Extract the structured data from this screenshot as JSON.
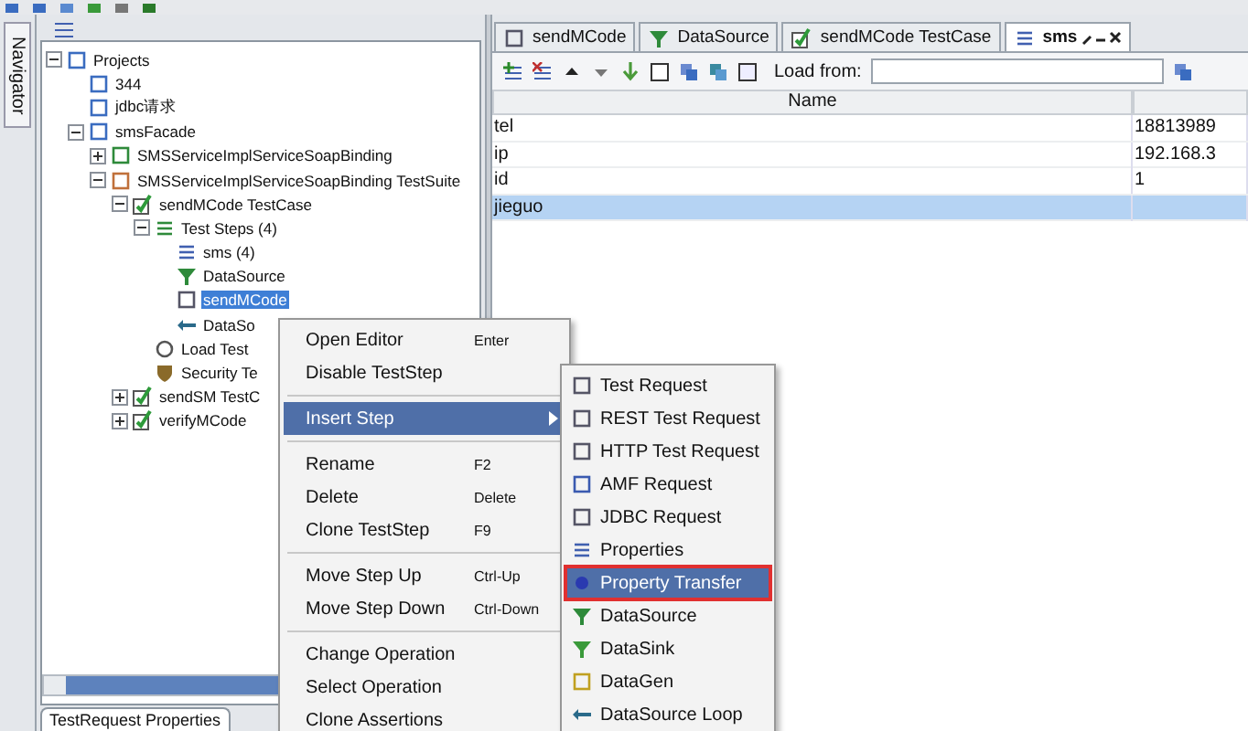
{
  "navigator": {
    "label": "Navigator"
  },
  "tree": [
    {
      "label": "Projects",
      "kind": "projects",
      "expanded": true,
      "selected": false,
      "children": [
        {
          "label": "344",
          "kind": "project",
          "selected": false
        },
        {
          "label": "jdbc请求",
          "kind": "project",
          "selected": false
        },
        {
          "label": "smsFacade",
          "kind": "project",
          "expanded": true,
          "selected": false,
          "children": [
            {
              "label": "SMSServiceImplServiceSoapBinding",
              "kind": "interface",
              "expanded": false,
              "selected": false
            },
            {
              "label": "SMSServiceImplServiceSoapBinding TestSuite",
              "kind": "suite",
              "expanded": true,
              "selected": false,
              "children": [
                {
                  "label": "sendMCode TestCase",
                  "kind": "case",
                  "expanded": true,
                  "selected": false,
                  "children": [
                    {
                      "label": "Test Steps (4)",
                      "kind": "steps",
                      "expanded": true,
                      "selected": false,
                      "children": [
                        {
                          "label": "sms (4)",
                          "kind": "properties",
                          "selected": false
                        },
                        {
                          "label": "DataSource",
                          "kind": "datasource",
                          "selected": false
                        },
                        {
                          "label": "sendMCode",
                          "kind": "soap",
                          "selected": true
                        },
                        {
                          "label": "DataSo",
                          "kind": "loop",
                          "selected": false
                        }
                      ]
                    },
                    {
                      "label": "Load Test",
                      "kind": "load",
                      "selected": false
                    },
                    {
                      "label": "Security Te",
                      "kind": "security",
                      "selected": false
                    }
                  ]
                },
                {
                  "label": "sendSM TestC",
                  "kind": "case",
                  "expanded": false,
                  "selected": false
                },
                {
                  "label": "verifyMCode",
                  "kind": "case",
                  "expanded": false,
                  "selected": false
                }
              ]
            }
          ]
        }
      ]
    }
  ],
  "bottom_tabs": [
    {
      "label": "TestRequest Properties",
      "selected": true
    }
  ],
  "editor_tabs": [
    {
      "label": "sendMCode",
      "kind": "soap",
      "selected": false
    },
    {
      "label": "DataSource",
      "kind": "datasource",
      "selected": false
    },
    {
      "label": "sendMCode TestCase",
      "kind": "case",
      "selected": false
    },
    {
      "label": "sms",
      "kind": "properties",
      "selected": true
    }
  ],
  "toolbar": {
    "load_label": "Load from:"
  },
  "table": {
    "columns": [
      "Name"
    ],
    "rows": [
      {
        "name": "tel",
        "value": "18813989",
        "selected": false
      },
      {
        "name": "ip",
        "value": "192.168.3",
        "selected": false
      },
      {
        "name": "id",
        "value": "1",
        "selected": false
      },
      {
        "name": "jieguo",
        "selected": true
      }
    ]
  },
  "context_menu": {
    "groups": [
      [
        {
          "label": "Open Editor",
          "shortcut": "Enter",
          "selected": false,
          "submenu": false
        },
        {
          "label": "Disable TestStep",
          "selected": false,
          "submenu": false
        }
      ],
      [
        {
          "label": "Insert Step",
          "selected": true,
          "submenu": true
        }
      ],
      [
        {
          "label": "Rename",
          "shortcut": "F2",
          "selected": false,
          "submenu": false
        },
        {
          "label": "Delete",
          "shortcut": "Delete",
          "selected": false,
          "submenu": false
        },
        {
          "label": "Clone TestStep",
          "shortcut": "F9",
          "selected": false,
          "submenu": false
        }
      ],
      [
        {
          "label": "Move Step Up",
          "shortcut": "Ctrl-Up",
          "selected": false,
          "submenu": false
        },
        {
          "label": "Move Step Down",
          "shortcut": "Ctrl-Down",
          "selected": false,
          "submenu": false
        }
      ],
      [
        {
          "label": "Change Operation",
          "selected": false,
          "submenu": false
        },
        {
          "label": "Select Operation",
          "selected": false,
          "submenu": false
        },
        {
          "label": "Clone Assertions",
          "selected": false,
          "submenu": false
        }
      ]
    ]
  },
  "submenu": [
    {
      "label": "Test Request",
      "kind": "soap",
      "selected": false,
      "outlined": false
    },
    {
      "label": "REST Test Request",
      "kind": "rest",
      "selected": false,
      "outlined": false
    },
    {
      "label": "HTTP Test Request",
      "kind": "http",
      "selected": false,
      "outlined": false
    },
    {
      "label": "AMF Request",
      "kind": "amf",
      "selected": false,
      "outlined": false
    },
    {
      "label": "JDBC Request",
      "kind": "jdbc",
      "selected": false,
      "outlined": false
    },
    {
      "label": "Properties",
      "kind": "properties",
      "selected": false,
      "outlined": false
    },
    {
      "label": "Property Transfer",
      "kind": "transfer",
      "selected": true,
      "outlined": true
    },
    {
      "label": "DataSource",
      "kind": "datasource",
      "selected": false,
      "outlined": false
    },
    {
      "label": "DataSink",
      "kind": "datasink",
      "selected": false,
      "outlined": false
    },
    {
      "label": "DataGen",
      "kind": "datagen",
      "selected": false,
      "outlined": false
    },
    {
      "label": "DataSource Loop",
      "kind": "loop",
      "selected": false,
      "outlined": false
    }
  ]
}
